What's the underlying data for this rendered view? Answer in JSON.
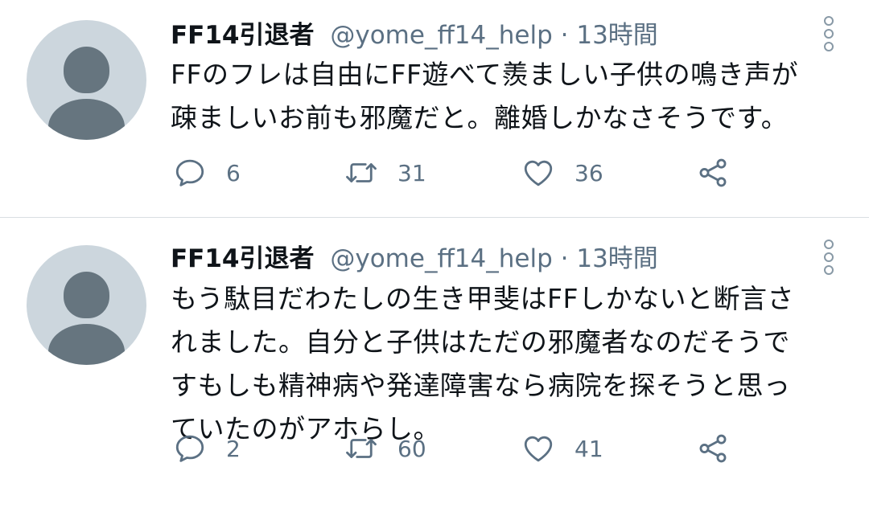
{
  "tweets": [
    {
      "name": "FF14引退者",
      "handle": "@yome_ff14_help",
      "separator": "·",
      "time": "13時間",
      "text": "FFのフレは自由にFF遊べて羨ましい子供の鳴き声が\n疎ましいお前も邪魔だと。離婚しかなさそうです。",
      "replies": "6",
      "retweets": "31",
      "likes": "36"
    },
    {
      "name": "FF14引退者",
      "handle": "@yome_ff14_help",
      "separator": "·",
      "time": "13時間",
      "text": "もう駄目だわたしの生き甲斐はFFしかないと断言さ\nれました。自分と子供はただの邪魔者なのだそうで\nすもしも精神病や発達障害なら病院を探そうと思っ\nていたのがアホらし。",
      "replies": "2",
      "retweets": "60",
      "likes": "41"
    }
  ],
  "icons": {
    "reply": "reply-icon",
    "retweet": "retweet-icon",
    "like": "heart-icon",
    "share": "share-icon",
    "more": "more-vertical-icon"
  },
  "colors": {
    "text": "#0f1419",
    "secondary": "#5b7083",
    "avatar_bg": "#ccd6dd",
    "avatar_fg": "#66757f",
    "divider": "#d9dee2"
  }
}
